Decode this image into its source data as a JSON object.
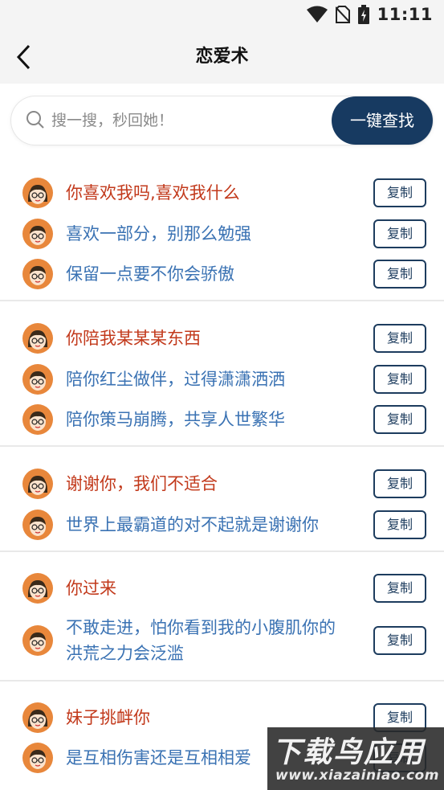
{
  "status_bar": {
    "time": "11:11",
    "icons": [
      "wifi-icon",
      "no-sim-icon",
      "battery-charging-icon"
    ]
  },
  "app_bar": {
    "title": "恋爱术",
    "back_icon": "chevron-left-icon"
  },
  "search": {
    "placeholder": "搜一搜，秒回她！",
    "button_label": "一键查找"
  },
  "copy_label": "复制",
  "colors": {
    "accent": "#173a61",
    "female_line": "#c2391b",
    "male_line": "#3a72b3"
  },
  "groups": [
    {
      "lines": [
        {
          "speaker": "female",
          "text": "你喜欢我吗,喜欢我什么"
        },
        {
          "speaker": "male",
          "text": "喜欢一部分，别那么勉强"
        },
        {
          "speaker": "male",
          "text": "保留一点要不你会骄傲"
        }
      ]
    },
    {
      "lines": [
        {
          "speaker": "female",
          "text": "你陪我某某某东西"
        },
        {
          "speaker": "male",
          "text": "陪你红尘做伴，过得潇潇洒洒"
        },
        {
          "speaker": "male",
          "text": "陪你策马崩腾，共享人世繁华"
        }
      ]
    },
    {
      "lines": [
        {
          "speaker": "female",
          "text": "谢谢你，我们不适合"
        },
        {
          "speaker": "male",
          "text": "世界上最霸道的对不起就是谢谢你"
        }
      ]
    },
    {
      "lines": [
        {
          "speaker": "female",
          "text": "你过来"
        },
        {
          "speaker": "male",
          "text": "不敢走进，怕你看到我的小腹肌你的",
          "text_line2": "洪荒之力会泛滥"
        }
      ]
    },
    {
      "lines": [
        {
          "speaker": "female",
          "text": "妹子挑衅你"
        },
        {
          "speaker": "male",
          "text": "是互相伤害还是互相相爱"
        }
      ]
    }
  ],
  "watermark": {
    "title": "下载鸟应用",
    "url": "www.xiazainiao.com"
  }
}
